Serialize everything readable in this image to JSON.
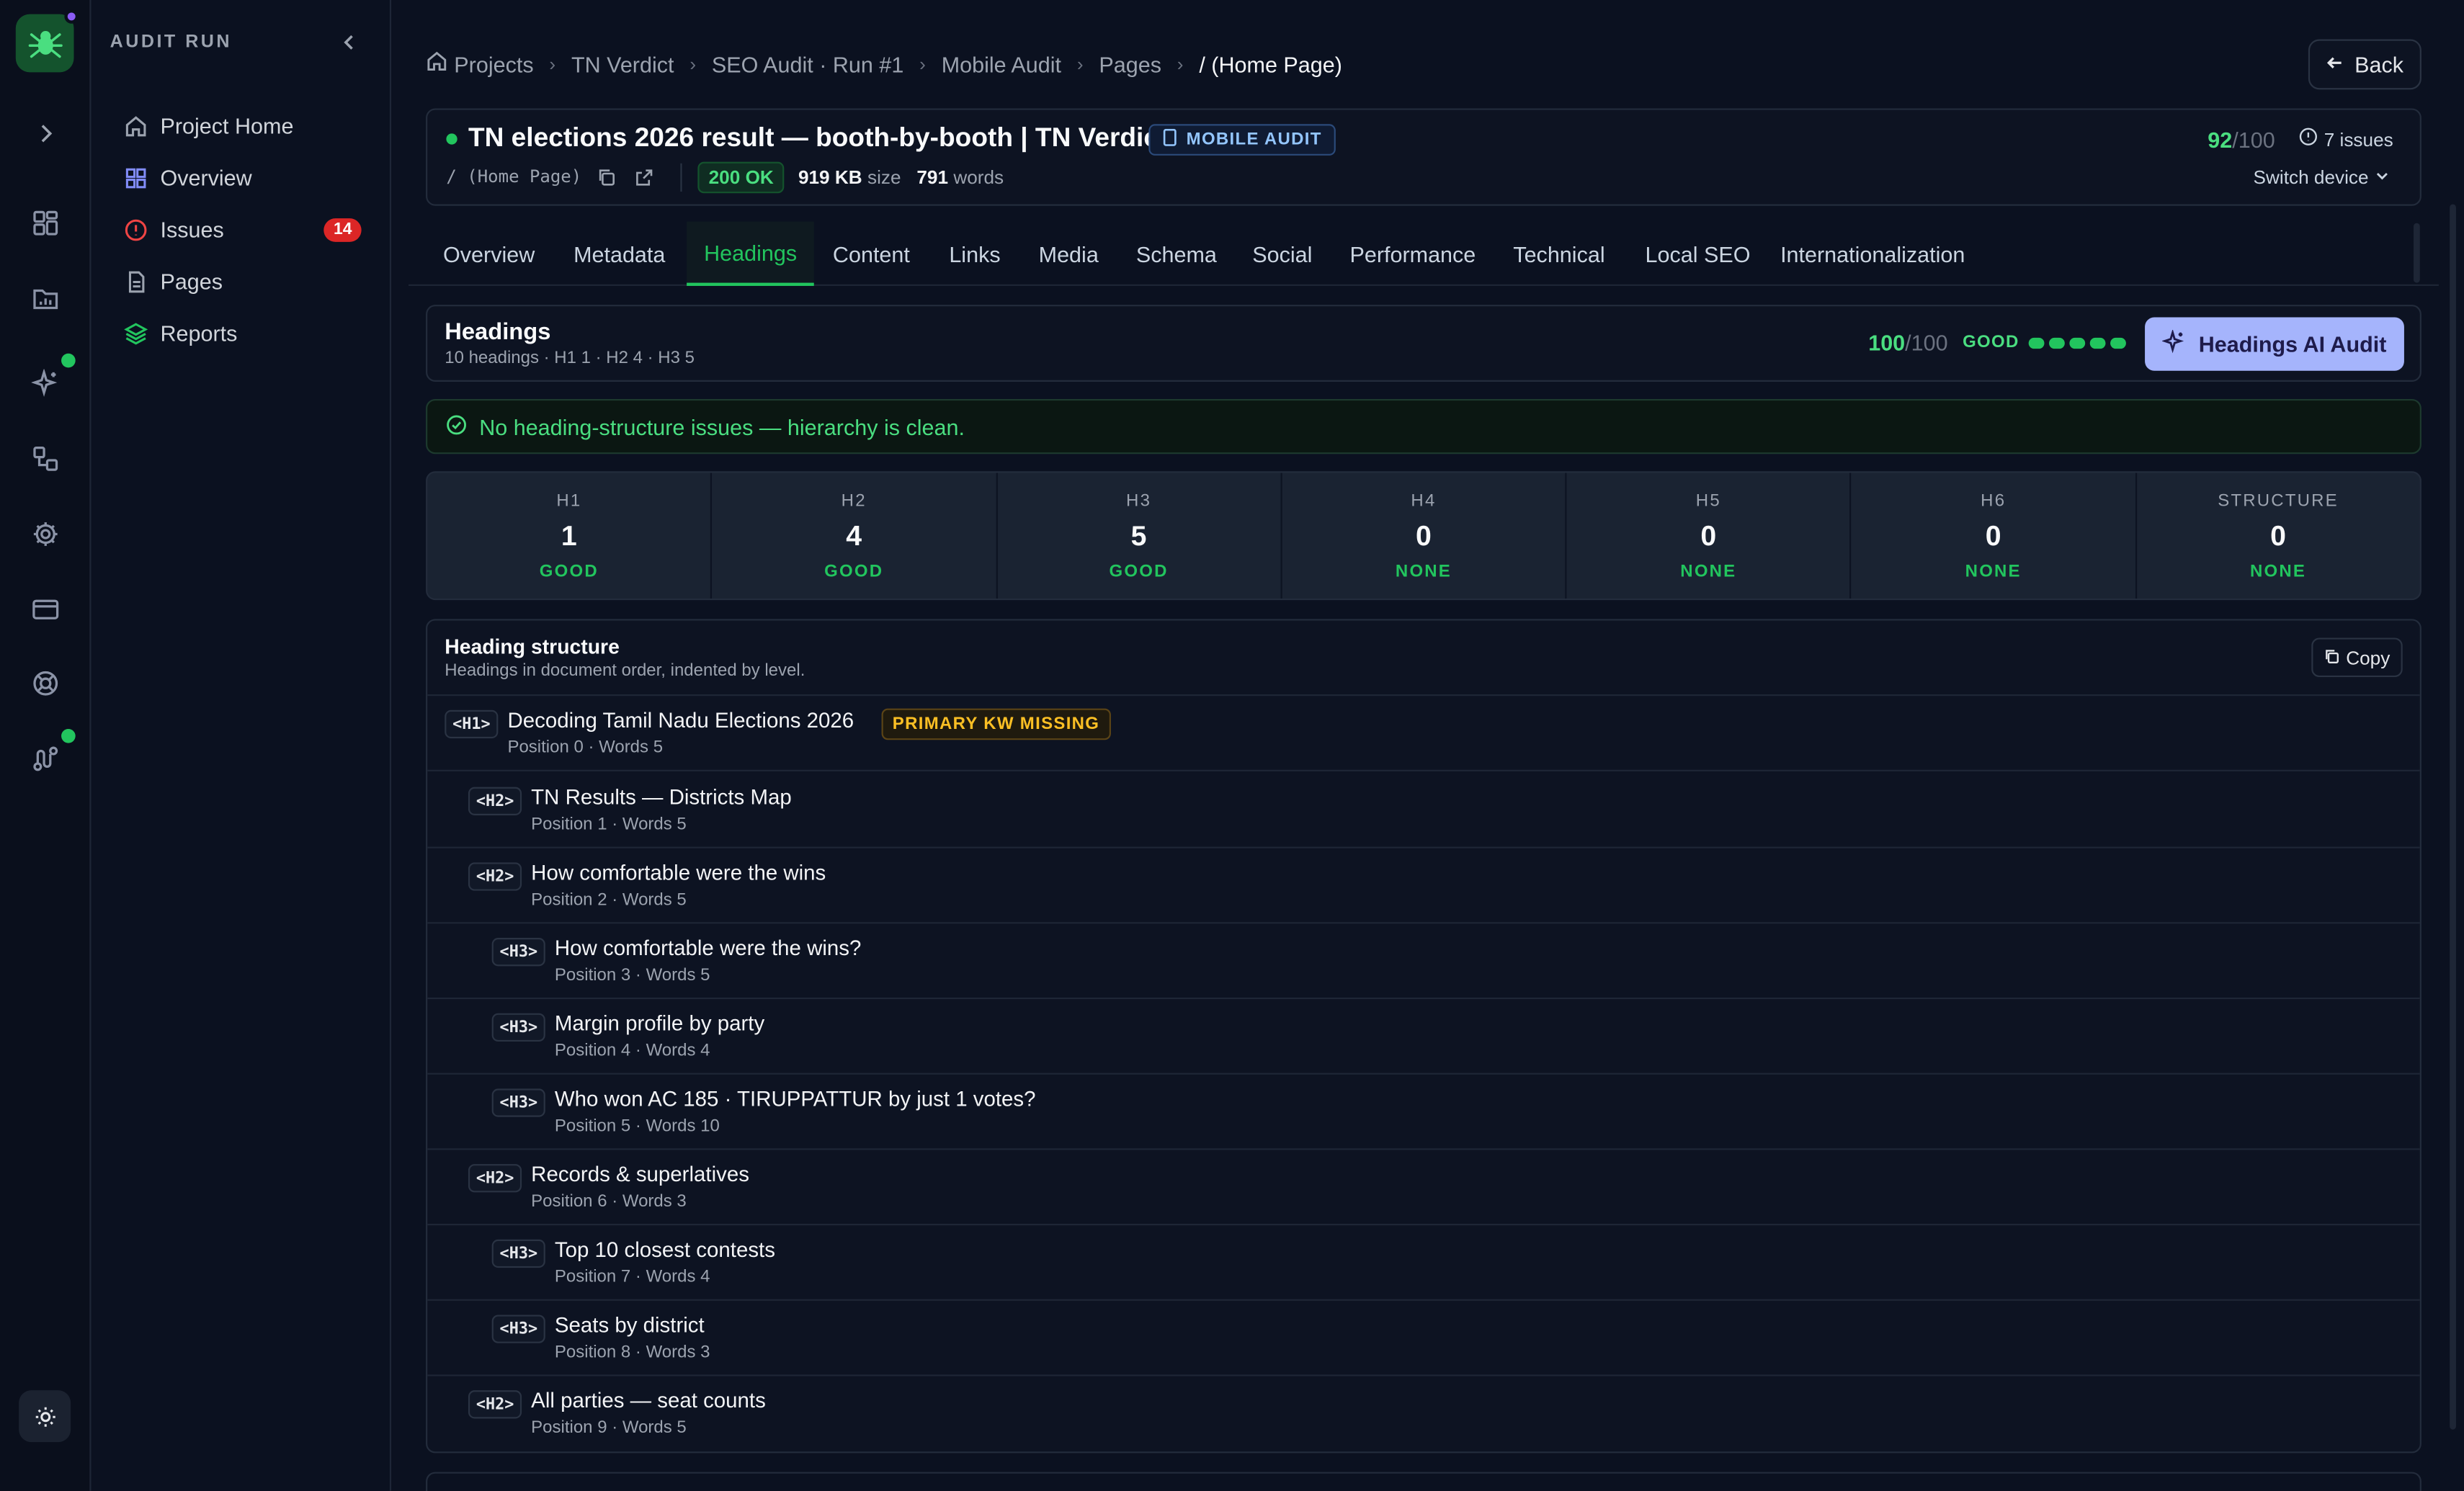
{
  "sidebar": {
    "title": "AUDIT RUN",
    "items": [
      {
        "label": "Project Home",
        "icon": "home-icon"
      },
      {
        "label": "Overview",
        "icon": "grid-icon"
      },
      {
        "label": "Issues",
        "icon": "alert-circle-icon",
        "badge": "14"
      },
      {
        "label": "Pages",
        "icon": "file-icon"
      },
      {
        "label": "Reports",
        "icon": "layers-icon"
      }
    ]
  },
  "breadcrumb": [
    "Projects",
    "TN Verdict",
    "SEO Audit · Run #1",
    "Mobile Audit",
    "Pages",
    "/ (Home Page)"
  ],
  "back_label": "Back",
  "page": {
    "title": "TN elections 2026 result — booth-by-booth | TN Verdict",
    "badge": "MOBILE AUDIT",
    "path": "/ (Home Page)",
    "status": "200 OK",
    "size_value": "919 KB",
    "size_label": "size",
    "words_value": "791",
    "words_label": "words",
    "score": "92",
    "score_max": "/100",
    "issues": "7 issues",
    "switch_device": "Switch device"
  },
  "tabs": [
    "Overview",
    "Metadata",
    "Headings",
    "Content",
    "Links",
    "Media",
    "Schema",
    "Social",
    "Performance",
    "Technical",
    "Local SEO",
    "Internationalization"
  ],
  "active_tab": "Headings",
  "section": {
    "title": "Headings",
    "subtitle": "10 headings · H1 1 · H2 4 · H3 5",
    "score": "100",
    "score_max": "/100",
    "grade": "GOOD",
    "ai_button": "Headings AI Audit"
  },
  "ok_message": "No heading-structure issues — hierarchy is clean.",
  "levels": [
    {
      "label": "H1",
      "count": "1",
      "status": "GOOD"
    },
    {
      "label": "H2",
      "count": "4",
      "status": "GOOD"
    },
    {
      "label": "H3",
      "count": "5",
      "status": "GOOD"
    },
    {
      "label": "H4",
      "count": "0",
      "status": "NONE"
    },
    {
      "label": "H5",
      "count": "0",
      "status": "NONE"
    },
    {
      "label": "H6",
      "count": "0",
      "status": "NONE"
    },
    {
      "label": "STRUCTURE",
      "count": "0",
      "status": "NONE"
    }
  ],
  "structure": {
    "title": "Heading structure",
    "subtitle": "Headings in document order, indented by level.",
    "copy_label": "Copy",
    "rows": [
      {
        "tag": "<H1>",
        "text": "Decoding Tamil Nadu Elections 2026",
        "meta": "Position 0 · Words 5",
        "flag": "PRIMARY KW MISSING"
      },
      {
        "tag": "<H2>",
        "text": "TN Results — Districts Map",
        "meta": "Position 1 · Words 5"
      },
      {
        "tag": "<H2>",
        "text": "How comfortable were the wins",
        "meta": "Position 2 · Words 5"
      },
      {
        "tag": "<H3>",
        "text": "How comfortable were the wins?",
        "meta": "Position 3 · Words 5"
      },
      {
        "tag": "<H3>",
        "text": "Margin profile by party",
        "meta": "Position 4 · Words 4"
      },
      {
        "tag": "<H3>",
        "text": "Who won AC 185 · TIRUPPATTUR by just 1 votes?",
        "meta": "Position 5 · Words 10"
      },
      {
        "tag": "<H2>",
        "text": "Records & superlatives",
        "meta": "Position 6 · Words 3"
      },
      {
        "tag": "<H3>",
        "text": "Top 10 closest contests",
        "meta": "Position 7 · Words 4"
      },
      {
        "tag": "<H3>",
        "text": "Seats by district",
        "meta": "Position 8 · Words 3"
      },
      {
        "tag": "<H2>",
        "text": "All parties — seat counts",
        "meta": "Position 9 · Words 5"
      }
    ]
  },
  "colors": {
    "accent": "#22c55e",
    "ai_button": "#a5b4fc",
    "badge": "#dc2626",
    "warning": "#fbbf24"
  }
}
